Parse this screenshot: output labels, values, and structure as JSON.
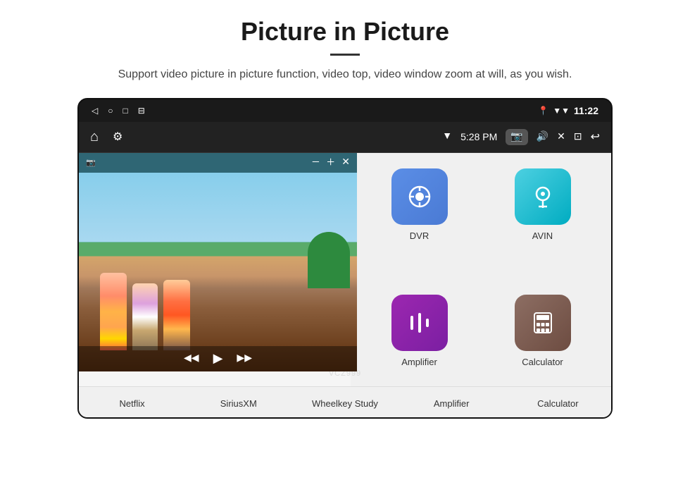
{
  "page": {
    "title": "Picture in Picture",
    "divider": true,
    "subtitle": "Support video picture in picture function, video top, video window zoom at will, as you wish."
  },
  "statusbar": {
    "time": "11:22",
    "battery_icon": "🔋",
    "wifi_icon": "▼",
    "location_icon": "📍"
  },
  "navbar": {
    "time": "5:28 PM",
    "back_icon": "◁",
    "home_icon": "○",
    "recent_icon": "□",
    "media_icon": "⊟",
    "return_icon": "↩"
  },
  "pip": {
    "camera_icon": "📷",
    "minus_label": "−",
    "plus_label": "+",
    "close_icon": "✕",
    "play_prev": "◀◀",
    "play_next": "▶▶",
    "play_pause": "▶"
  },
  "apps": [
    {
      "id": "dvr",
      "label": "DVR",
      "icon_type": "blue",
      "icon_symbol": "◉"
    },
    {
      "id": "avin",
      "label": "AVIN",
      "icon_type": "teal",
      "icon_symbol": "🎛"
    },
    {
      "id": "amplifier",
      "label": "Amplifier",
      "icon_type": "purple",
      "icon_symbol": "≡"
    },
    {
      "id": "calculator",
      "label": "Calculator",
      "icon_type": "brown",
      "icon_symbol": "⊞"
    }
  ],
  "bottom_apps": [
    {
      "label": "Netflix"
    },
    {
      "label": "SiriusXM"
    },
    {
      "label": "Wheelkey Study"
    },
    {
      "label": "Amplifier"
    },
    {
      "label": "Calculator"
    }
  ],
  "watermark": "VCZ999"
}
